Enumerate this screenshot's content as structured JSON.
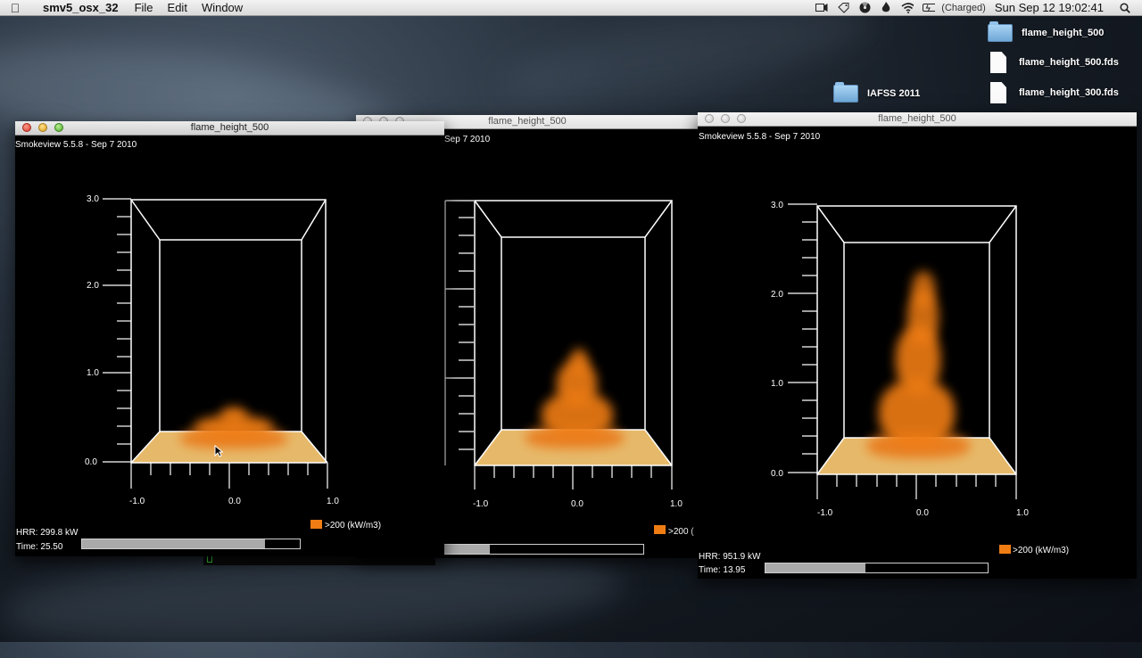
{
  "menubar": {
    "app_name": "smv5_osx_32",
    "items": [
      "File",
      "Edit",
      "Window"
    ],
    "battery_status": "(Charged)",
    "clock": "Sun Sep 12  19:02:41"
  },
  "desktop": {
    "icons": [
      {
        "label": "flame_height_500",
        "kind": "folder"
      },
      {
        "label": "flame_height_500.fds",
        "kind": "document"
      },
      {
        "label": "IAFSS 2011",
        "kind": "folder"
      },
      {
        "label": "flame_height_300.fds",
        "kind": "document"
      }
    ]
  },
  "windows": [
    {
      "title": "flame_height_500",
      "version": "Smokeview 5.5.8 - Sep  7 2010",
      "y_ticks": [
        "3.0",
        "2.0",
        "1.0",
        "0.0"
      ],
      "x_ticks": [
        "-1.0",
        "0.0",
        "1.0"
      ],
      "hrr": "HRR: 299.8 kW",
      "time": "Time: 25.50",
      "legend": ">200 (kW/m3)",
      "time_progress": 0.84
    },
    {
      "title": "flame_height_500",
      "version": "Sep  7 2010",
      "x_ticks": [
        "-1.0",
        "0.0",
        "1.0"
      ],
      "legend": ">200 (",
      "time_progress": 0.31
    },
    {
      "title": "flame_height_500",
      "version": "Smokeview 5.5.8 - Sep  7 2010",
      "y_ticks": [
        "3.0",
        "2.0",
        "1.0",
        "0.0"
      ],
      "x_ticks": [
        "-1.0",
        "0.0",
        "1.0"
      ],
      "hrr": "HRR: 951.9 kW",
      "time": "Time: 13.95",
      "legend": ">200 (kW/m3)",
      "time_progress": 0.45
    }
  ],
  "colors": {
    "flame": "#f07d14",
    "floor": "#e6b96a",
    "box": "#ffffff"
  }
}
